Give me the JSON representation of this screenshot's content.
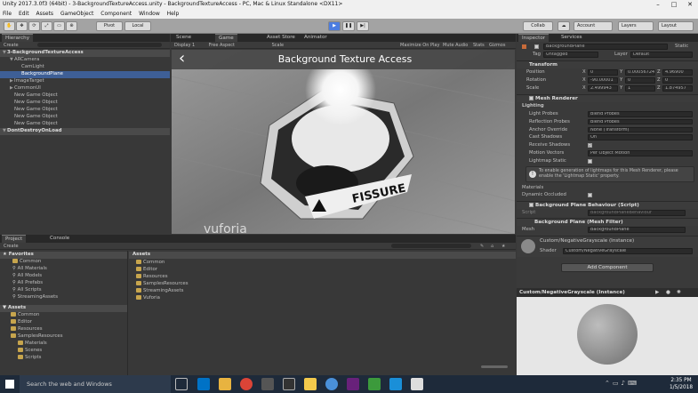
{
  "title": "Unity 2017.3.0f3 (64bit) - 3-BackgroundTextureAccess.unity - BackgroundTextureAccess - PC, Mac & Linux Standalone <DX11>",
  "menu": [
    "File",
    "Edit",
    "Assets",
    "GameObject",
    "Component",
    "Window",
    "Help"
  ],
  "toolbar": {
    "pivot": "Pivot",
    "local": "Local",
    "collab": "Collab",
    "account": "Account",
    "layers": "Layers",
    "layout": "Layout"
  },
  "hierarchy": {
    "tab": "Hierarchy",
    "create": "Create",
    "items": [
      {
        "label": "3-BackgroundTextureAccess",
        "indent": 0,
        "kind": "scene"
      },
      {
        "label": "ARCamera",
        "indent": 1,
        "kind": "node"
      },
      {
        "label": "CamLight",
        "indent": 2,
        "kind": "leaf"
      },
      {
        "label": "BackgroundPlane",
        "indent": 2,
        "kind": "leaf",
        "selected": true
      },
      {
        "label": "ImageTarget",
        "indent": 1,
        "kind": "node"
      },
      {
        "label": "CommonUI",
        "indent": 1,
        "kind": "node"
      },
      {
        "label": "New Game Object",
        "indent": 1,
        "kind": "leaf"
      },
      {
        "label": "New Game Object",
        "indent": 1,
        "kind": "leaf"
      },
      {
        "label": "New Game Object",
        "indent": 1,
        "kind": "leaf"
      },
      {
        "label": "New Game Object",
        "indent": 1,
        "kind": "leaf"
      },
      {
        "label": "New Game Object",
        "indent": 1,
        "kind": "leaf"
      },
      {
        "label": "DontDestroyOnLoad",
        "indent": 0,
        "kind": "scene"
      }
    ]
  },
  "gameview": {
    "tabs": [
      "Scene",
      "Game",
      "Asset Store",
      "Animator"
    ],
    "display": "Display 1",
    "aspect": "Free Aspect",
    "scale": "Scale",
    "options": [
      "Maximize On Play",
      "Mute Audio",
      "Stats",
      "Gizmos"
    ],
    "heading": "Background Texture Access",
    "back": "‹",
    "product": "FISSURE",
    "watermark": "vuforia"
  },
  "inspector": {
    "tabs": [
      "Inspector",
      "Services"
    ],
    "object": "BackgroundPlane",
    "static": "Static",
    "tag_label": "Tag",
    "tag": "Untagged",
    "layer_label": "Layer",
    "layer": "Default",
    "transform": {
      "title": "Transform",
      "rows": [
        {
          "label": "Position",
          "x": "0",
          "y": "0.00056724",
          "z": "4.96900"
        },
        {
          "label": "Rotation",
          "x": "-90.00001",
          "y": "0",
          "z": "0"
        },
        {
          "label": "Scale",
          "x": "2.499943",
          "y": "1",
          "z": "1.874957"
        }
      ]
    },
    "renderer": {
      "title": "Mesh Renderer",
      "lighting": "Lighting",
      "rows": [
        {
          "label": "Light Probes",
          "value": "Blend Probes"
        },
        {
          "label": "Reflection Probes",
          "value": "Blend Probes"
        },
        {
          "label": "Anchor Override",
          "value": "None (Transform)"
        },
        {
          "label": "Cast Shadows",
          "value": "On"
        },
        {
          "label": "Receive Shadows",
          "value": "✓"
        },
        {
          "label": "Motion Vectors",
          "value": "Per Object Motion"
        },
        {
          "label": "Lightmap Static",
          "value": ""
        }
      ],
      "note": "To enable generation of lightmaps for this Mesh Renderer, please enable the 'Lightmap Static' property.",
      "materials": "Materials",
      "dynamic": "Dynamic Occluded"
    },
    "behaviour": {
      "title": "Background Plane Behaviour (Script)",
      "script_label": "Script",
      "script": "BackgroundPlaneBehaviour"
    },
    "filter": {
      "title": "Background Plane (Mesh Filter)",
      "mesh_label": "Mesh",
      "mesh": "BackgroundPlane"
    },
    "material": {
      "name": "Custom/NegativeGrayscale (Instance)",
      "shader_label": "Shader",
      "shader": "Custom/NegativeGrayscale"
    },
    "add": "Add Component",
    "preview": "Custom/NegativeGrayscale (Instance)"
  },
  "project": {
    "tabs": [
      "Project",
      "Console"
    ],
    "create": "Create",
    "favorites": "Favorites",
    "fav": [
      "Common",
      "All Materials",
      "All Models",
      "All Prefabs",
      "All Scripts",
      "StreamingAssets"
    ],
    "assets": "Assets",
    "tree": [
      {
        "label": "Common",
        "indent": 1
      },
      {
        "label": "Editor",
        "indent": 1
      },
      {
        "label": "Resources",
        "indent": 1
      },
      {
        "label": "SamplesResources",
        "indent": 1
      },
      {
        "label": "Materials",
        "indent": 2
      },
      {
        "label": "Scenes",
        "indent": 2
      },
      {
        "label": "Scripts",
        "indent": 2
      }
    ],
    "breadcrumb": "Assets",
    "folders": [
      "Common",
      "Editor",
      "Resources",
      "SamplesResources",
      "StreamingAssets",
      "Vuforia"
    ]
  },
  "taskbar": {
    "search": "Search the web and Windows",
    "time": "2:35 PM",
    "date": "1/5/2018"
  },
  "colors": {
    "accent": "#3e5f96",
    "taskbar": "#1e2a3a",
    "playbtn": "#4c7de0"
  }
}
